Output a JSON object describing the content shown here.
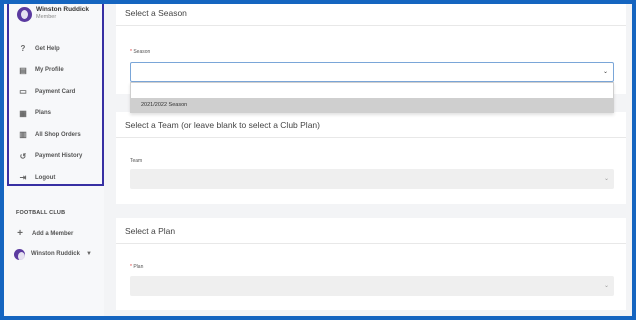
{
  "sidebar": {
    "user": {
      "name": "Winston Ruddick",
      "role": "Member"
    },
    "items": [
      {
        "label": "Get Help",
        "icon": "question-icon"
      },
      {
        "label": "My Profile",
        "icon": "id-card-icon"
      },
      {
        "label": "Payment Card",
        "icon": "credit-card-icon"
      },
      {
        "label": "Plans",
        "icon": "clipboard-icon"
      },
      {
        "label": "All Shop Orders",
        "icon": "receipt-icon"
      },
      {
        "label": "Payment History",
        "icon": "history-icon"
      },
      {
        "label": "Logout",
        "icon": "logout-icon"
      }
    ],
    "club_title": "FOOTBALL CLUB",
    "add_member": "Add a Member",
    "member_name": "Winston Ruddick"
  },
  "season_card": {
    "title": "Select a Season",
    "label": "Season",
    "required": "*",
    "options": [
      "2021/2022 Season"
    ]
  },
  "team_card": {
    "title": "Select a Team (or leave blank to select a Club Plan)",
    "label": "Team"
  },
  "plan_card": {
    "title": "Select a Plan",
    "label": "Plan",
    "required": "*"
  },
  "colors": {
    "frame_border": "#1565c0",
    "highlight_box": "#3730a3",
    "avatar": "#5b3aa0"
  }
}
